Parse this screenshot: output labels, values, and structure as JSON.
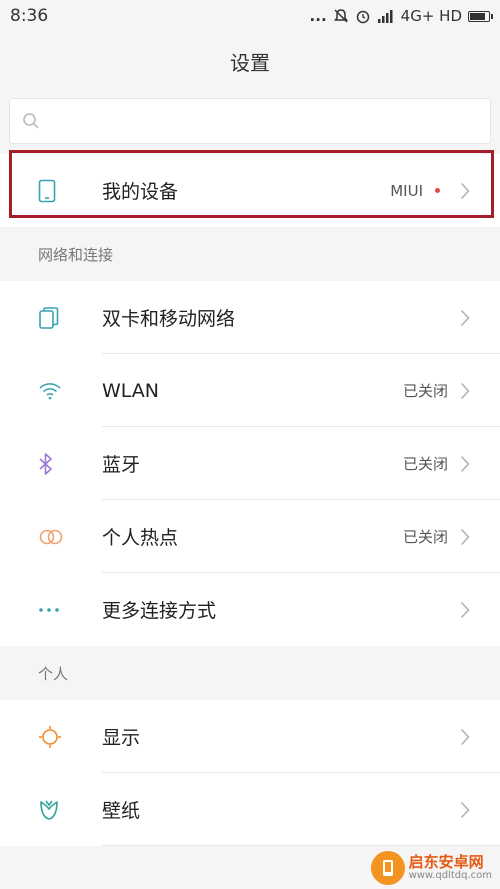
{
  "status_bar": {
    "time": "8:36",
    "dots": "...",
    "network": "4G+ HD"
  },
  "title": "设置",
  "search": {
    "placeholder": ""
  },
  "device": {
    "label": "我的设备",
    "value": "MIUI"
  },
  "sections": [
    {
      "header": "网络和连接",
      "items": [
        {
          "label": "双卡和移动网络",
          "value": ""
        },
        {
          "label": "WLAN",
          "value": "已关闭"
        },
        {
          "label": "蓝牙",
          "value": "已关闭"
        },
        {
          "label": "个人热点",
          "value": "已关闭"
        },
        {
          "label": "更多连接方式",
          "value": ""
        }
      ]
    },
    {
      "header": "个人",
      "items": [
        {
          "label": "显示",
          "value": ""
        },
        {
          "label": "壁纸",
          "value": ""
        }
      ]
    }
  ],
  "colors": {
    "accent_teal": "#36a4b0",
    "bluetooth_purple": "#9c7bd6",
    "hotspot_orange": "#f0a070",
    "display_orange": "#f08a2e",
    "wallpaper_teal": "#2fa39a",
    "highlight_red": "#a51e26",
    "badge_red": "#e34848"
  },
  "watermark": {
    "title": "启东安卓网",
    "subtitle": "www.qdltdq.com"
  }
}
